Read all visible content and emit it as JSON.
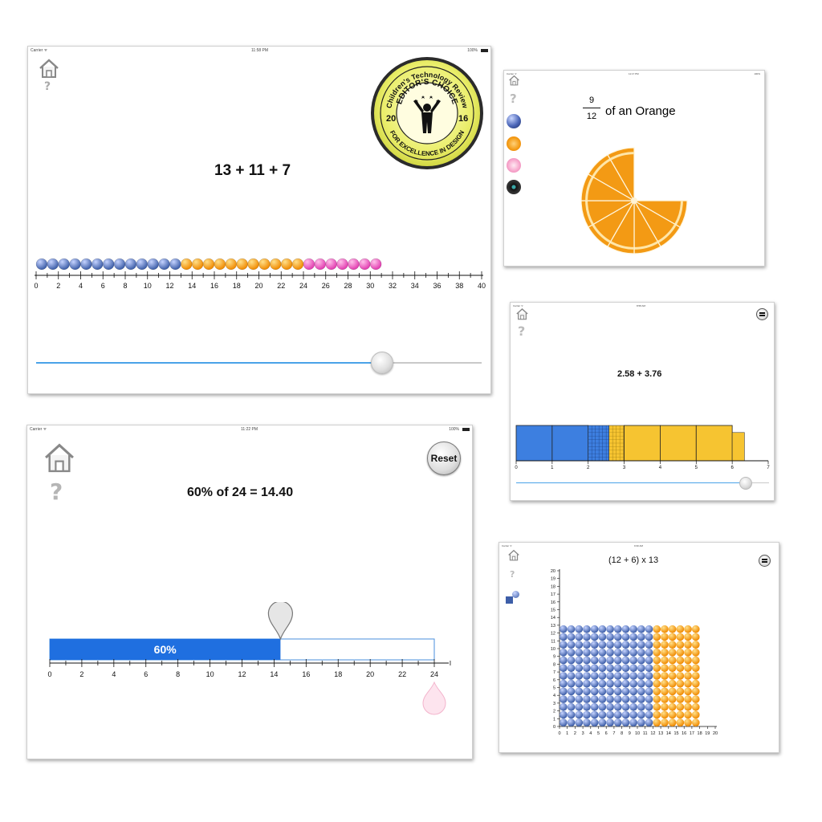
{
  "panel1": {
    "status": {
      "carrier": "Carrier ᯤ",
      "time": "11:58 PM",
      "battery": "100%"
    },
    "equation": "13 + 11 + 7",
    "award": {
      "top": "Children's Technology Review",
      "mid": "EDITOR'S CHOICE",
      "year_left": "20",
      "year_right": "16",
      "bottom": "FOR EXCELLENCE IN DESIGN"
    },
    "ticks": [
      "0",
      "2",
      "4",
      "6",
      "8",
      "10",
      "12",
      "14",
      "16",
      "18",
      "20",
      "22",
      "24",
      "26",
      "28",
      "30",
      "32",
      "34",
      "36",
      "38",
      "40"
    ],
    "beads": {
      "blue": 13,
      "orange": 11,
      "pink": 7
    },
    "slider_value": 31,
    "slider_max": 40
  },
  "panel2": {
    "status": {
      "carrier": "Carrier ᯤ",
      "time": "11:17 PM",
      "battery": "100%"
    },
    "numerator": "9",
    "denominator": "12",
    "text": "of an Orange",
    "slices_shown": 9,
    "slices_total": 12,
    "menu_icons": [
      "blue-ball-icon",
      "orange-icon",
      "flower-icon",
      "record-icon"
    ]
  },
  "panel3": {
    "status": {
      "carrier": "Carrier ᯤ",
      "time": "8:58 AM"
    },
    "equation": "2.58 + 3.76",
    "ticks": [
      "0",
      "1",
      "2",
      "3",
      "4",
      "5",
      "6",
      "7"
    ],
    "values": [
      2.58,
      3.76
    ],
    "slider_value": 6.34,
    "slider_max": 7
  },
  "panel4": {
    "status": {
      "carrier": "Carrier ᯤ",
      "time": "11:22 PM",
      "battery": "100%"
    },
    "reset_label": "Reset",
    "equation": "60% of 24 = 14.40",
    "bar_label": "60%",
    "percent": 0.6,
    "total": 24,
    "ticks": [
      "0",
      "2",
      "4",
      "6",
      "8",
      "10",
      "12",
      "14",
      "16",
      "18",
      "20",
      "22",
      "24"
    ]
  },
  "panel5": {
    "status": {
      "carrier": "Carrier ᯤ",
      "time": "9:30 AM"
    },
    "equation": "(12 + 6) x 13",
    "cols_blue": 12,
    "cols_orange": 6,
    "rows": 13,
    "x_ticks": [
      "0",
      "1",
      "2",
      "3",
      "4",
      "5",
      "6",
      "7",
      "8",
      "9",
      "10",
      "11",
      "12",
      "13",
      "14",
      "15",
      "16",
      "17",
      "18",
      "19",
      "20"
    ],
    "y_ticks": [
      "0",
      "1",
      "2",
      "3",
      "4",
      "5",
      "6",
      "7",
      "8",
      "9",
      "10",
      "11",
      "12",
      "13",
      "14",
      "15",
      "16",
      "17",
      "18",
      "19",
      "20"
    ]
  },
  "colors": {
    "blue_bead": "#3d5ea8",
    "orange_bead": "#f08a00",
    "pink_bead": "#e23cb0",
    "blue_bar": "#1f6fe0",
    "yellow_bar": "#f6c431",
    "orange_fruit": "#f39a14"
  }
}
